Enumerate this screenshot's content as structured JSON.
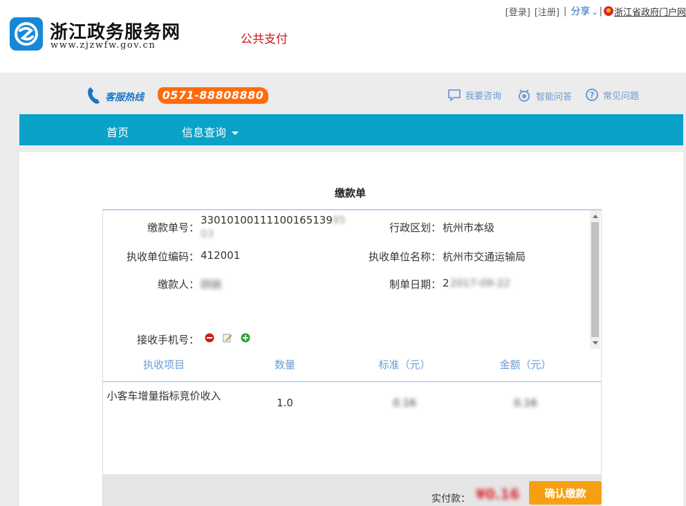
{
  "header": {
    "site_name": "浙江政务服务网",
    "site_url": "www.zjzwfw.gov.cn",
    "page_tag": "公共支付",
    "login": "[登录]",
    "register": "[注册]",
    "share": "分享",
    "gov_portal": "浙江省政府门户网"
  },
  "hotline": {
    "label": "客服热线",
    "number": "0571-88808880"
  },
  "help_links": [
    {
      "label": "我要咨询",
      "icon": "chat-icon"
    },
    {
      "label": "智能问答",
      "icon": "robot-icon"
    },
    {
      "label": "常见问题",
      "icon": "question-icon"
    }
  ],
  "nav": {
    "home": "首页",
    "info_query": "信息查询"
  },
  "form": {
    "title": "缴款单",
    "fields": {
      "serial_label": "缴款单号：",
      "serial_value": "33010100111100165139",
      "serial_tail": "9503",
      "region_label": "行政区划：",
      "region_value": "杭州市本级",
      "unit_code_label": "执收单位编码：",
      "unit_code_value": "412001",
      "unit_name_label": "执收单位名称：",
      "unit_name_value": "杭州市交通运输局",
      "payer_label": "缴款人：",
      "payer_value": "顾娟",
      "date_label": "制单日期：",
      "date_value": "2017-09-22",
      "phone_label": "接收手机号："
    },
    "table": {
      "headers": [
        "执收项目",
        "数量",
        "标准（元）",
        "金额（元）"
      ],
      "rows": [
        {
          "item": "小客车增量指标竞价收入",
          "qty": "1.0",
          "standard": "0.16",
          "amount": "0.16"
        }
      ]
    },
    "total_label": "实付款：",
    "total_value": "¥0.16",
    "confirm_label": "确认缴款"
  },
  "colors": {
    "nav": "#0aa2c9",
    "hotline": "#ff6a0c",
    "confirm": "#f5a013",
    "accent_red": "#c8161d"
  }
}
